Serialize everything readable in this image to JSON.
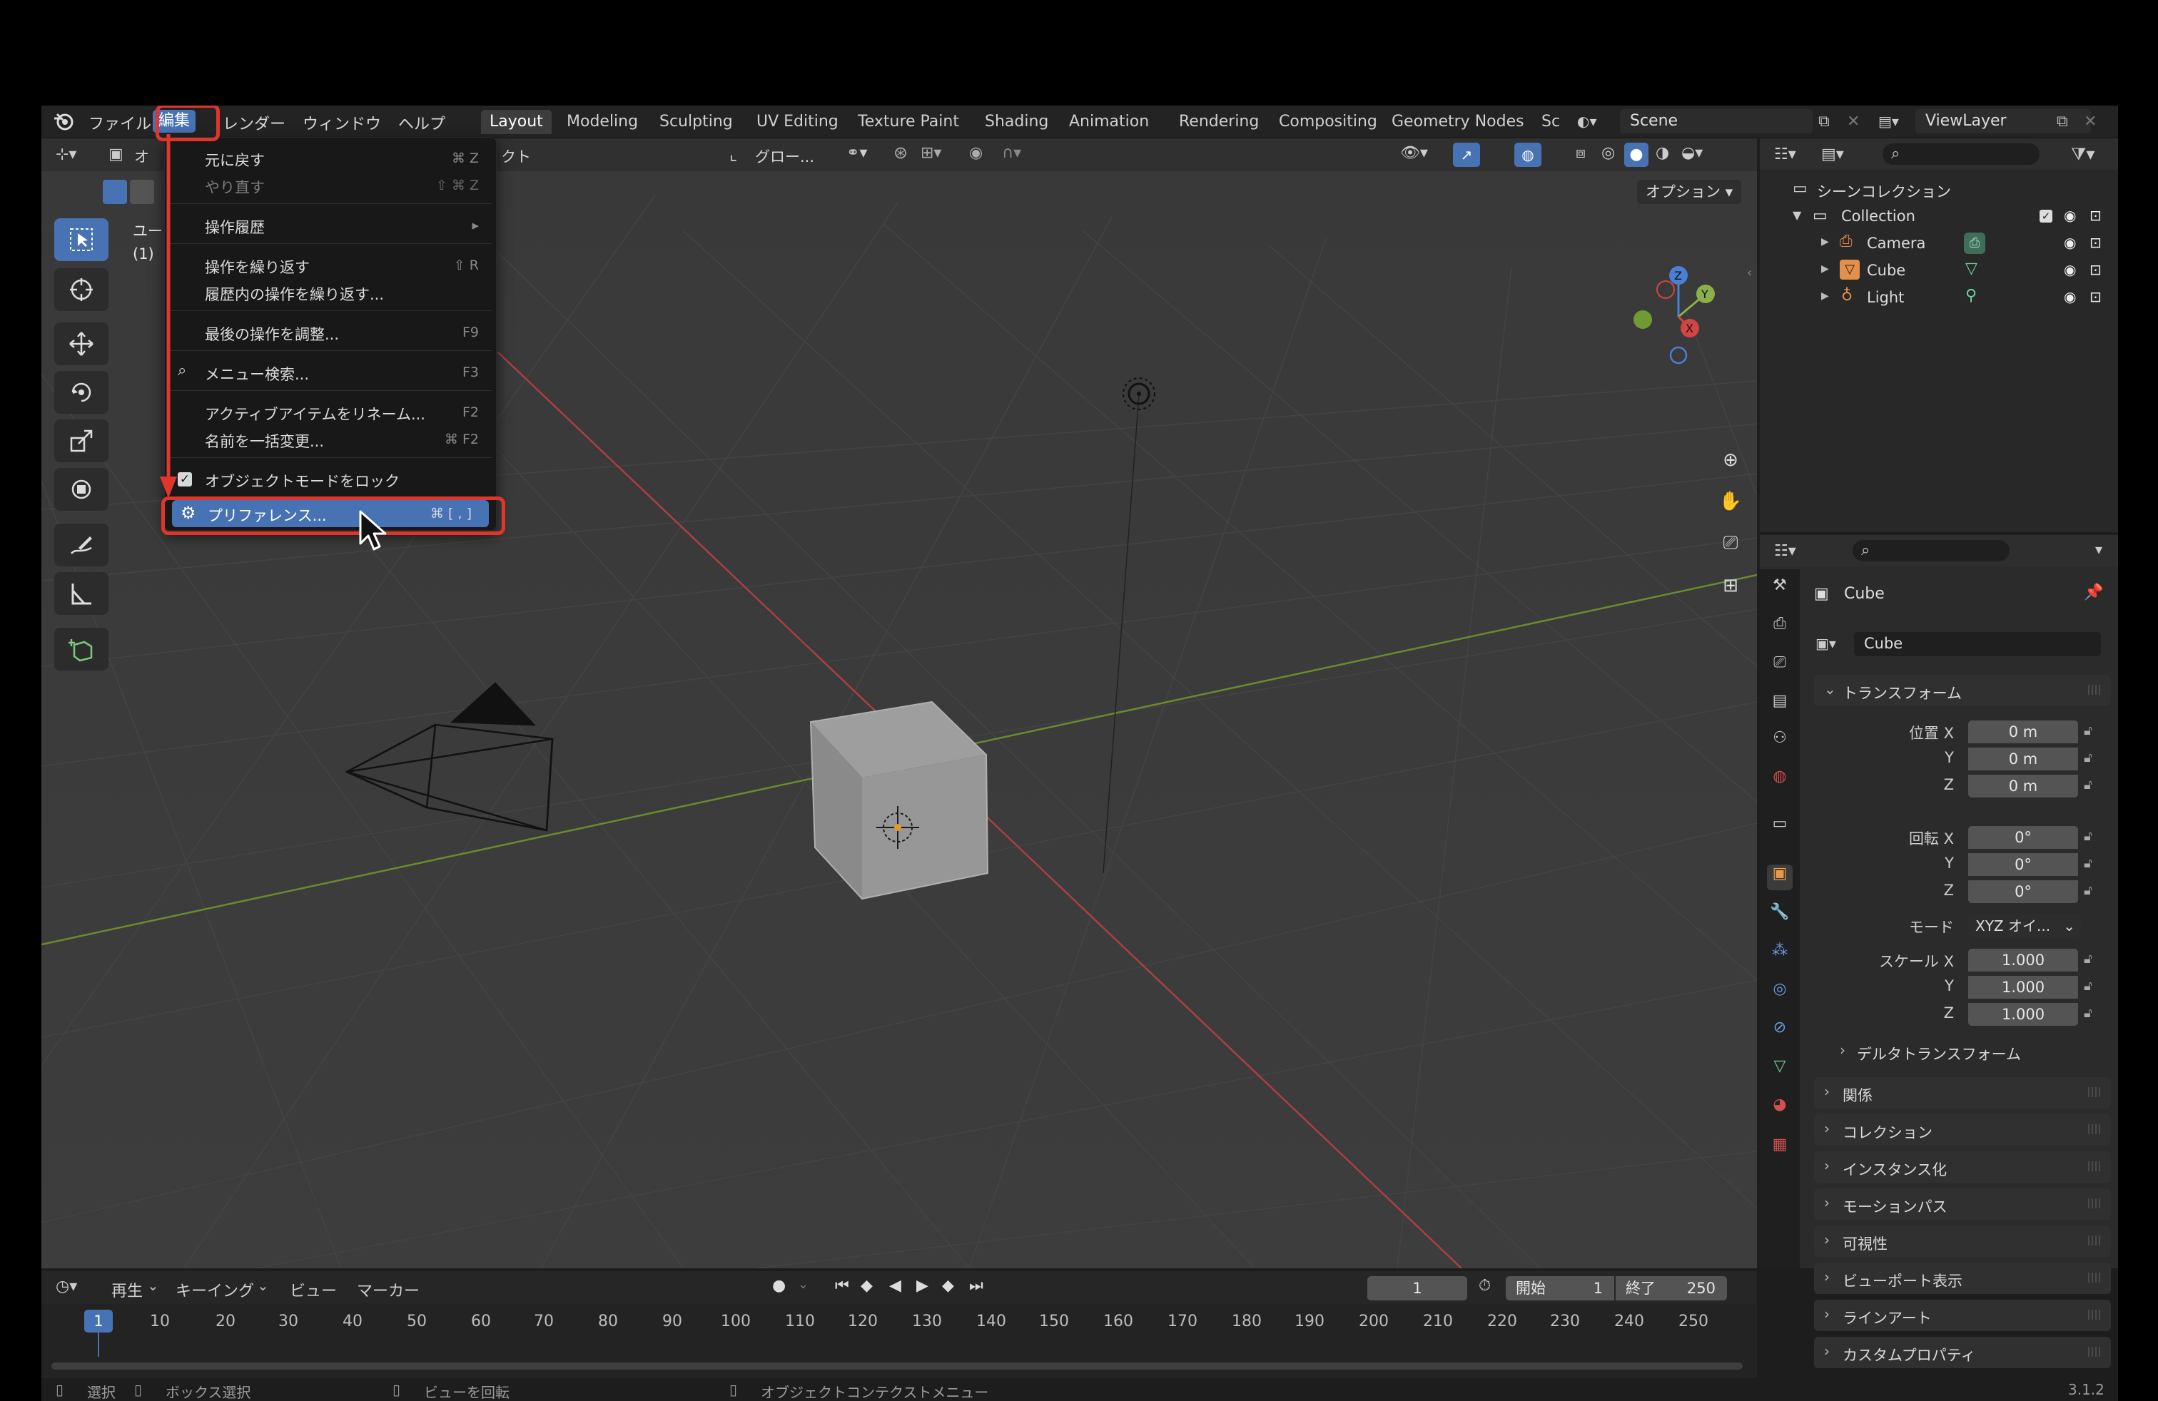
{
  "topbar": {
    "menus": [
      "ファイル",
      "編集",
      "レンダー",
      "ウィンドウ",
      "ヘルプ"
    ],
    "workspaces": [
      "Layout",
      "Modeling",
      "Sculpting",
      "UV Editing",
      "Texture Paint",
      "Shading",
      "Animation",
      "Rendering",
      "Compositing",
      "Geometry Nodes",
      "Sc"
    ],
    "scene": "Scene",
    "view_layer": "ViewLayer"
  },
  "viewport": {
    "header_partial_1": "オ",
    "header_partial_2": "クト",
    "transform_orientation": "グロー...",
    "options": "オプション",
    "overlay_text_1": "ユー",
    "overlay_text_2": "(1)"
  },
  "edit_menu": {
    "items": [
      {
        "label": "元に戻す",
        "shortcut": "⌘ Z",
        "disabled": false
      },
      {
        "label": "やり直す",
        "shortcut": "⇧ ⌘ Z",
        "disabled": true
      },
      {
        "label": "操作履歴",
        "shortcut": "▸",
        "disabled": false
      },
      {
        "label": "操作を繰り返す",
        "shortcut": "⇧ R",
        "disabled": false
      },
      {
        "label": "履歴内の操作を繰り返す...",
        "shortcut": "",
        "disabled": false
      },
      {
        "label": "最後の操作を調整...",
        "shortcut": "F9",
        "disabled": false
      },
      {
        "label": "メニュー検索...",
        "shortcut": "F3",
        "disabled": false
      },
      {
        "label": "アクティブアイテムをリネーム...",
        "shortcut": "F2",
        "disabled": false
      },
      {
        "label": "名前を一括変更...",
        "shortcut": "⌘ F2",
        "disabled": false
      },
      {
        "label": "オブジェクトモードをロック",
        "shortcut": "",
        "disabled": false
      },
      {
        "label": "プリファレンス...",
        "shortcut": "⌘ [ , ]",
        "disabled": false
      }
    ]
  },
  "outliner": {
    "scene_collection": "シーンコレクション",
    "collection": "Collection",
    "objects": [
      "Camera",
      "Cube",
      "Light"
    ]
  },
  "properties": {
    "object_name": "Cube",
    "data_name": "Cube",
    "transform_panel": "トランスフォーム",
    "location_label": "位置 X",
    "rotation_label": "回転 X",
    "scale_label": "スケール X",
    "axis_y": "Y",
    "axis_z": "Z",
    "location": [
      "0 m",
      "0 m",
      "0 m"
    ],
    "rotation": [
      "0°",
      "0°",
      "0°"
    ],
    "mode_label": "モード",
    "mode_value": "XYZ オイ...",
    "scale": [
      "1.000",
      "1.000",
      "1.000"
    ],
    "delta_transform": "デルタトランスフォーム",
    "panels": [
      "関係",
      "コレクション",
      "インスタンス化",
      "モーションパス",
      "可視性",
      "ビューポート表示",
      "ラインアート",
      "カスタムプロパティ"
    ]
  },
  "timeline": {
    "menus": [
      "再生",
      "キーイング",
      "ビュー",
      "マーカー"
    ],
    "current_frame": "1",
    "start_label": "開始",
    "start_value": "1",
    "end_label": "終了",
    "end_value": "250",
    "frame_numbers": [
      "1",
      "10",
      "20",
      "30",
      "40",
      "50",
      "60",
      "70",
      "80",
      "90",
      "100",
      "110",
      "120",
      "130",
      "140",
      "150",
      "160",
      "170",
      "180",
      "190",
      "200",
      "210",
      "220",
      "230",
      "240",
      "250"
    ]
  },
  "statusbar": {
    "select": "選択",
    "box_select": "ボックス選択",
    "rotate_view": "ビューを回転",
    "context_menu": "オブジェクトコンテクストメニュー",
    "version": "3.1.2"
  }
}
